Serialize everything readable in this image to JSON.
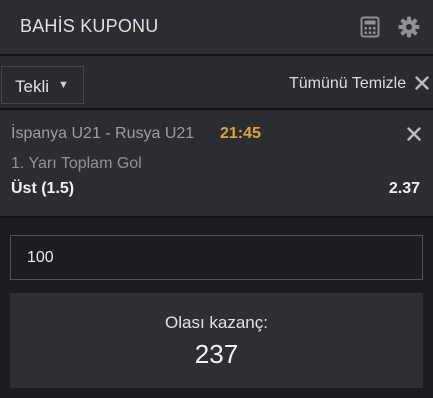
{
  "header": {
    "title": "BAHİS KUPONU",
    "icons": [
      "calculator-icon",
      "gear-icon"
    ]
  },
  "toolbar": {
    "bet_type": "Tekli",
    "clear_all": "Tümünü Temizle"
  },
  "bet": {
    "match": "İspanya U21 - Rusya U21",
    "time": "21:45",
    "market": "1. Yarı Toplam Gol",
    "selection": "Üst (1.5)",
    "odds": "2.37"
  },
  "stake": {
    "value": "100"
  },
  "winnings": {
    "label": "Olası kazanç:",
    "value": "237"
  },
  "colors": {
    "background": "#1c1d20",
    "panel": "#2c2d31",
    "accent_time": "#e0a23a"
  }
}
